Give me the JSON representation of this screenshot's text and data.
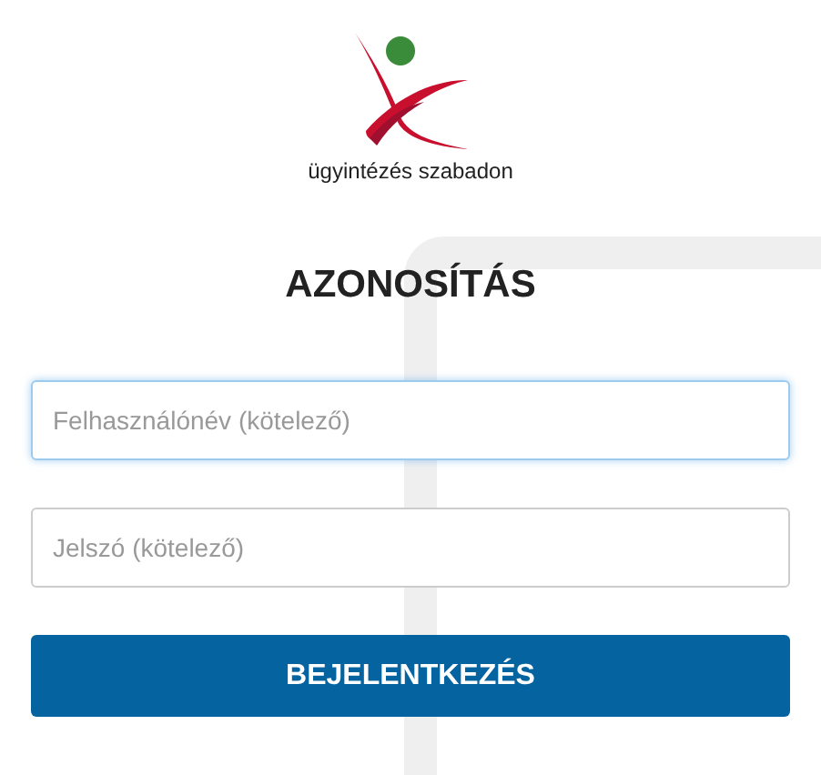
{
  "logo": {
    "tagline": "ügyintézés szabadon"
  },
  "title": "AZONOSÍTÁS",
  "fields": [
    {
      "placeholder": "Felhasználónév (kötelező)",
      "focused": true
    },
    {
      "placeholder": "Jelszó (kötelező)",
      "focused": false
    }
  ],
  "submit_button": "BEJELENTKEZÉS"
}
